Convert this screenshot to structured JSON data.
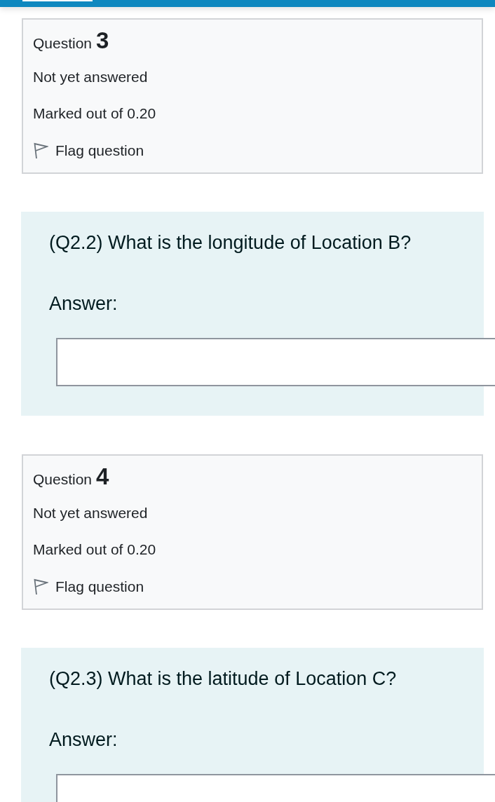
{
  "questions": [
    {
      "number_label": "Question",
      "number": "3",
      "status": "Not yet answered",
      "marks": "Marked out of 0.20",
      "flag_label": "Flag question",
      "flagged": false,
      "prompt": "(Q2.2) What is the longitude of Location B?",
      "answer_label": "Answer:"
    },
    {
      "number_label": "Question",
      "number": "4",
      "status": "Not yet answered",
      "marks": "Marked out of 0.20",
      "flag_label": "Flag question",
      "flagged": false,
      "prompt": "(Q2.3) What is the latitude of Location C?",
      "answer_label": "Answer:"
    }
  ]
}
